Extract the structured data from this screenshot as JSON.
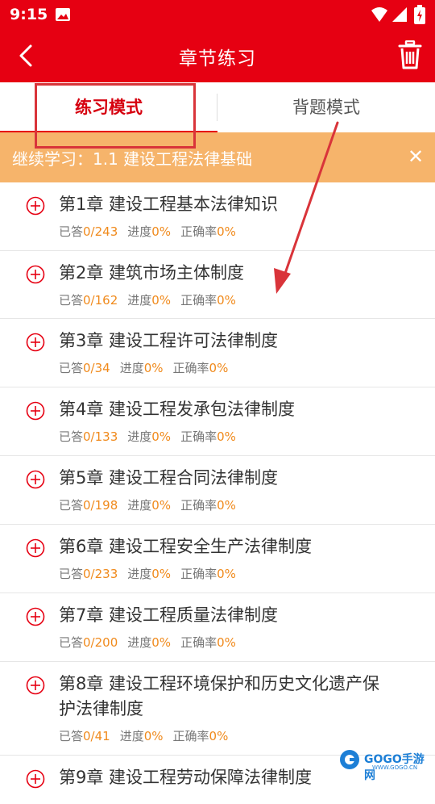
{
  "status_bar": {
    "time": "9:15"
  },
  "toolbar": {
    "title": "章节练习"
  },
  "tabs": [
    {
      "label": "练习模式",
      "active": true
    },
    {
      "label": "背题模式",
      "active": false
    }
  ],
  "resume_banner": {
    "text": "继续学习：1.1 建设工程法律基础"
  },
  "labels": {
    "answered": "已答",
    "progress": "进度",
    "accuracy": "正确率"
  },
  "chapters": [
    {
      "title": "第1章  建设工程基本法律知识",
      "answered": "0/243",
      "progress": "0%",
      "accuracy": "0%"
    },
    {
      "title": "第2章  建筑市场主体制度",
      "answered": "0/162",
      "progress": "0%",
      "accuracy": "0%"
    },
    {
      "title": "第3章  建设工程许可法律制度",
      "answered": "0/34",
      "progress": "0%",
      "accuracy": "0%"
    },
    {
      "title": "第4章  建设工程发承包法律制度",
      "answered": "0/133",
      "progress": "0%",
      "accuracy": "0%"
    },
    {
      "title": "第5章  建设工程合同法律制度",
      "answered": "0/198",
      "progress": "0%",
      "accuracy": "0%"
    },
    {
      "title": "第6章  建设工程安全生产法律制度",
      "answered": "0/233",
      "progress": "0%",
      "accuracy": "0%"
    },
    {
      "title": "第7章  建设工程质量法律制度",
      "answered": "0/200",
      "progress": "0%",
      "accuracy": "0%"
    },
    {
      "title": "第8章  建设工程环境保护和历史文化遗产保护法律制度",
      "answered": "0/41",
      "progress": "0%",
      "accuracy": "0%"
    },
    {
      "title": "第9章  建设工程劳动保障法律制度",
      "answered": "",
      "progress": "",
      "accuracy": ""
    }
  ],
  "watermark": {
    "text": "GOGO手游网",
    "sub": "WWW.GOGO.CN"
  },
  "colors": {
    "brand_red": "#e60012",
    "banner_orange": "#f6b46b",
    "stat_orange": "#f08a1c"
  },
  "icons": {
    "back": "chevron-left-icon",
    "delete": "trash-icon",
    "expand": "plus-circle-icon",
    "close": "close-icon"
  }
}
